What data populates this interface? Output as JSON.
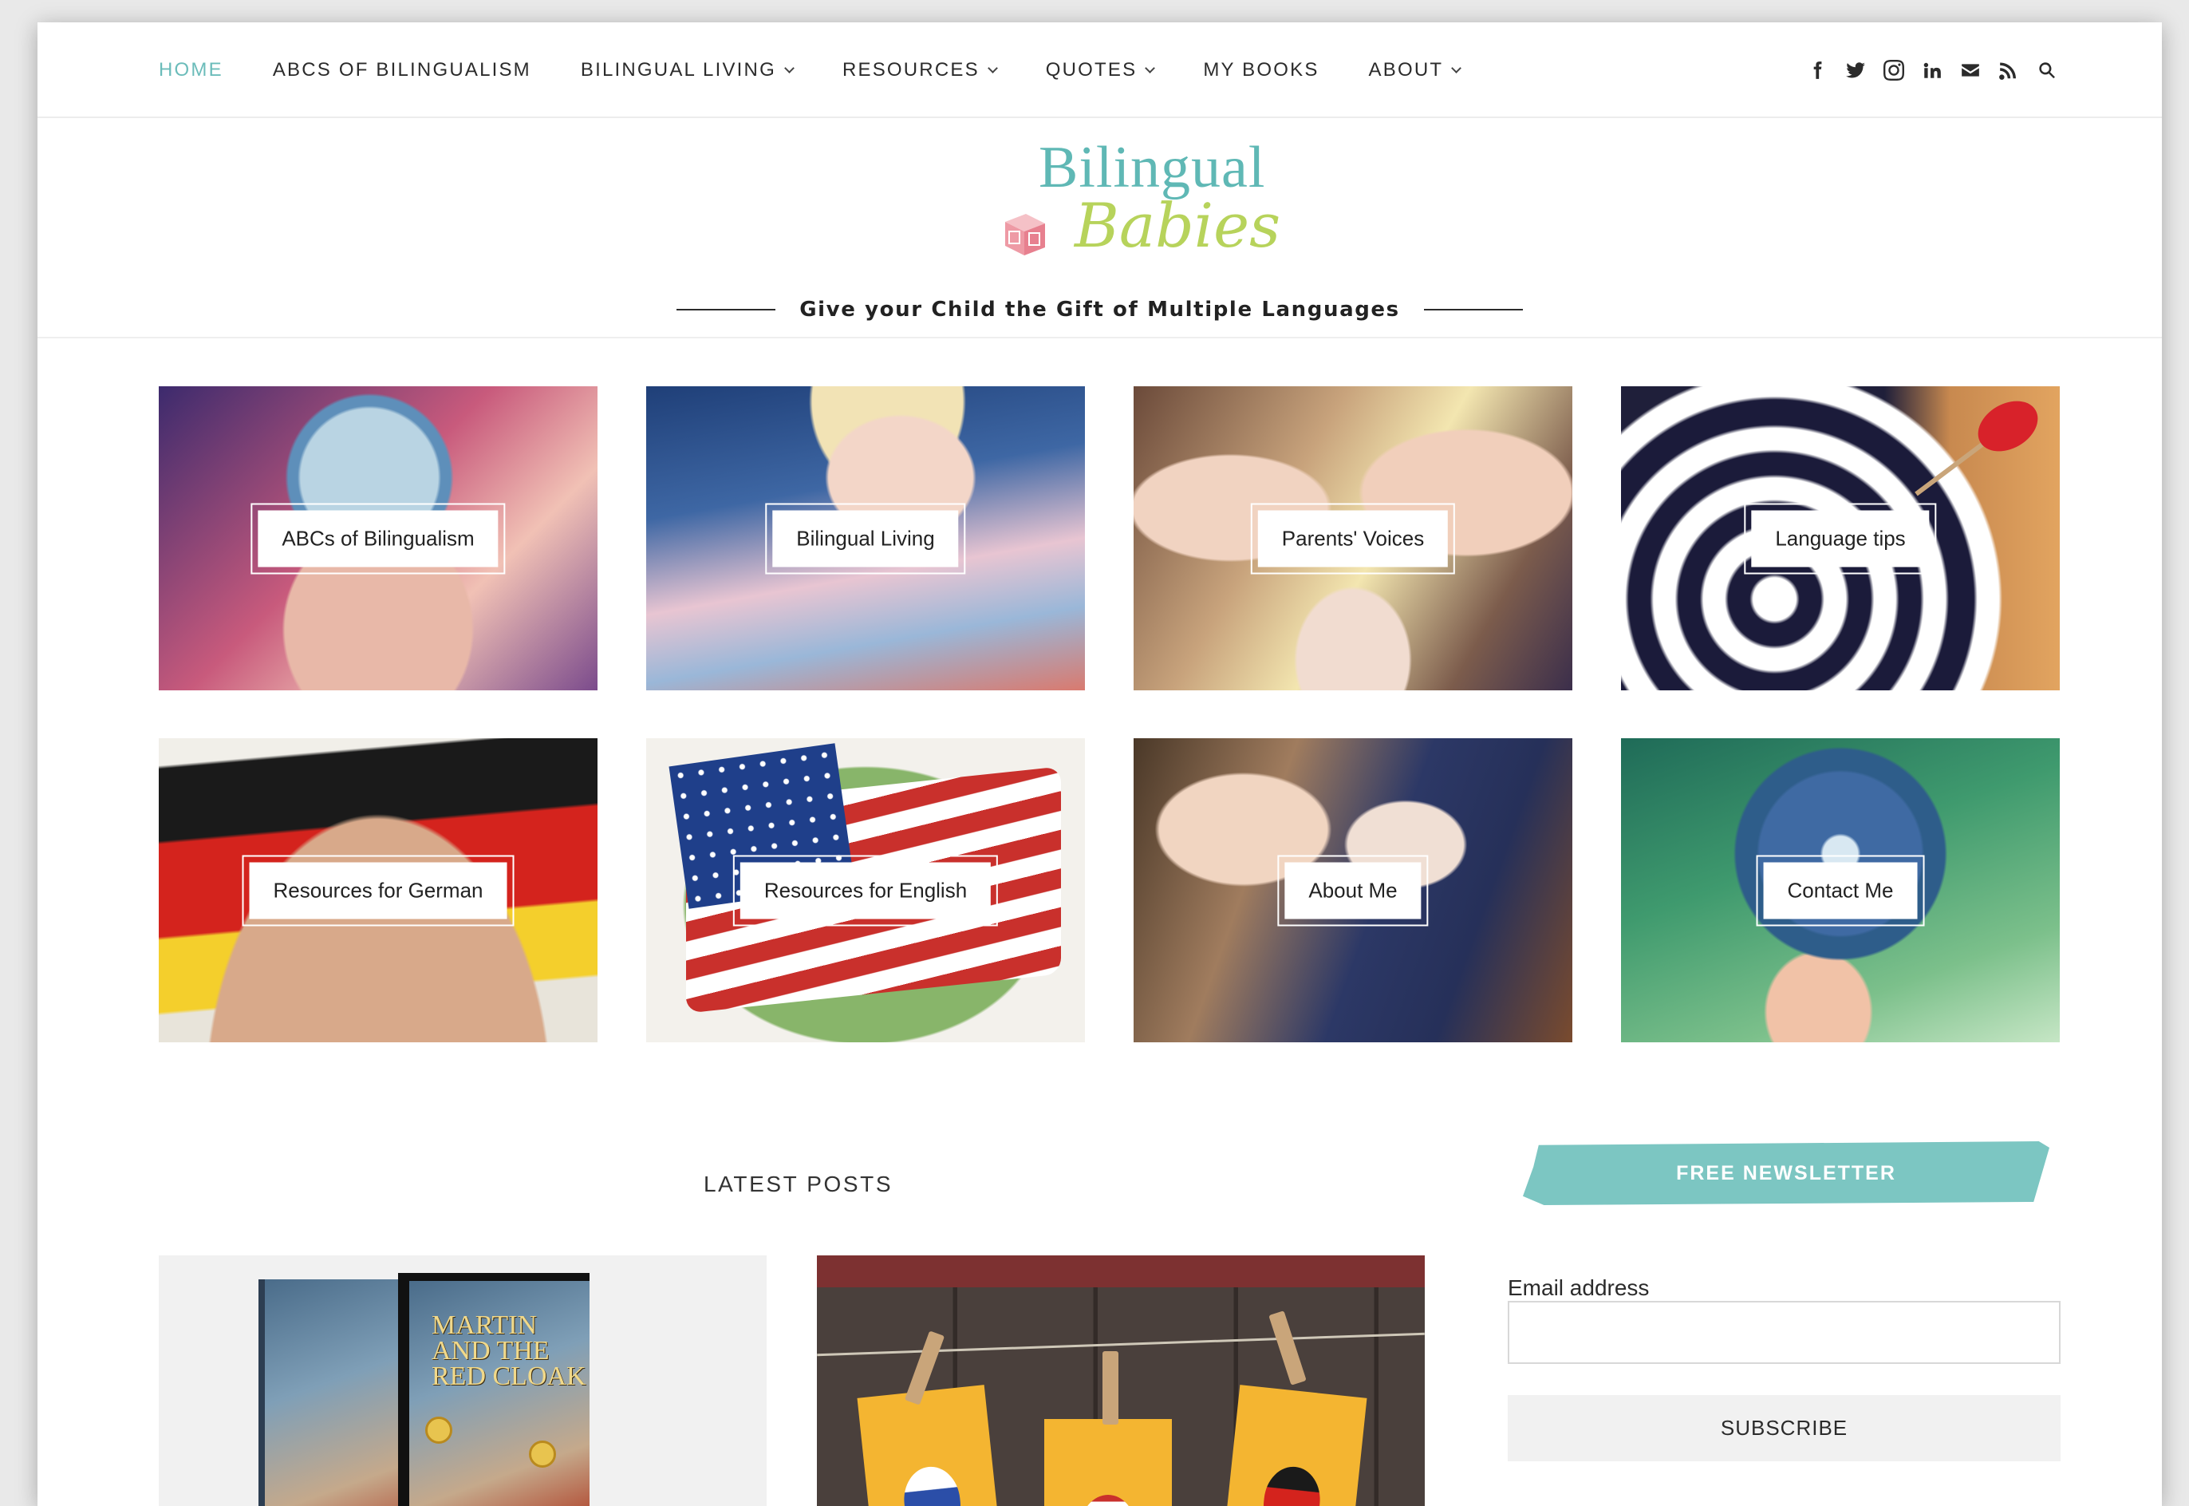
{
  "nav": {
    "items": [
      {
        "label": "HOME",
        "active": true,
        "dropdown": false
      },
      {
        "label": "ABCS OF BILINGUALISM",
        "active": false,
        "dropdown": false
      },
      {
        "label": "BILINGUAL LIVING",
        "active": false,
        "dropdown": true
      },
      {
        "label": "RESOURCES",
        "active": false,
        "dropdown": true
      },
      {
        "label": "QUOTES",
        "active": false,
        "dropdown": true
      },
      {
        "label": "MY BOOKS",
        "active": false,
        "dropdown": false
      },
      {
        "label": "ABOUT",
        "active": false,
        "dropdown": true
      }
    ],
    "social_icons": [
      "facebook-icon",
      "twitter-icon",
      "instagram-icon",
      "linkedin-icon",
      "email-icon",
      "rss-icon",
      "search-icon"
    ]
  },
  "brand": {
    "logo_top": "Bilingual",
    "logo_bottom": "Babies",
    "tagline": "Give your Child the Gift of Multiple Languages"
  },
  "categories": [
    {
      "label": "ABCs of Bilingualism"
    },
    {
      "label": "Bilingual Living"
    },
    {
      "label": "Parents' Voices"
    },
    {
      "label": "Language tips"
    },
    {
      "label": "Resources for German"
    },
    {
      "label": "Resources for English"
    },
    {
      "label": "About Me"
    },
    {
      "label": "Contact Me"
    }
  ],
  "latest": {
    "title": "LATEST POSTS",
    "book_cover_title": "MARTIN AND THE RED CLOAK"
  },
  "newsletter": {
    "banner": "FREE NEWSLETTER",
    "email_label": "Email address",
    "email_value": "",
    "email_placeholder": "",
    "button": "SUBSCRIBE"
  },
  "colors": {
    "accent": "#6bbcba",
    "newsletter_banner": "#7cc6c2",
    "logo_green": "#b7d35b"
  }
}
